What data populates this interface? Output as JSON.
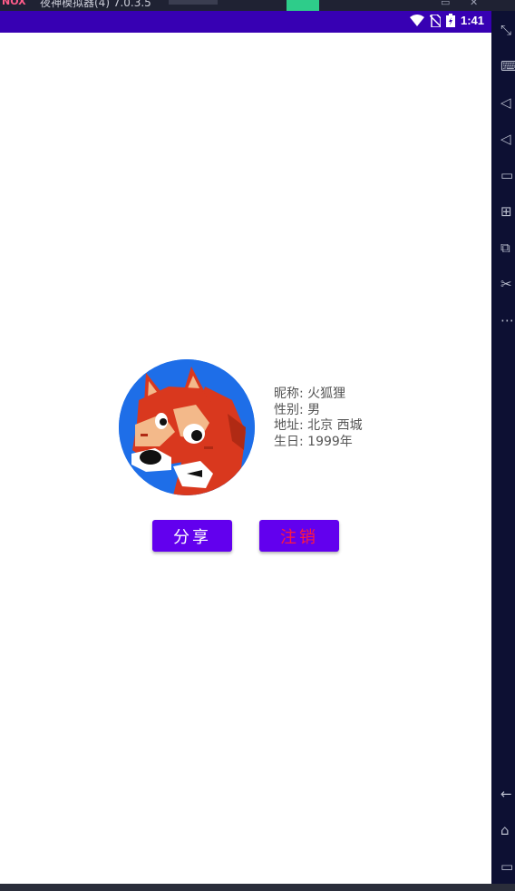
{
  "emulator": {
    "title": "夜神模拟器(4) 7.0.3.5",
    "logo": "NOX"
  },
  "statusbar": {
    "time": "1:41",
    "background": "#3700b3"
  },
  "profile": {
    "nickname_line": "昵称: 火狐狸",
    "gender_line": "性别: 男",
    "address_line": "地址: 北京 西城",
    "birthday_line": "生日: 1999年"
  },
  "buttons": {
    "share_label": "分享",
    "logout_label": "注销",
    "button_color": "#6200ee",
    "logout_text_color": "#ff1a3d"
  },
  "toolbar": {
    "icons": [
      "fullscreen-icon",
      "keyboard-icon",
      "volume-up-icon",
      "volume-down-icon",
      "screen-icon",
      "add-apk-icon",
      "multi-instance-icon",
      "scissors-icon",
      "more-icon",
      "back-icon",
      "home-icon",
      "recents-icon"
    ]
  }
}
